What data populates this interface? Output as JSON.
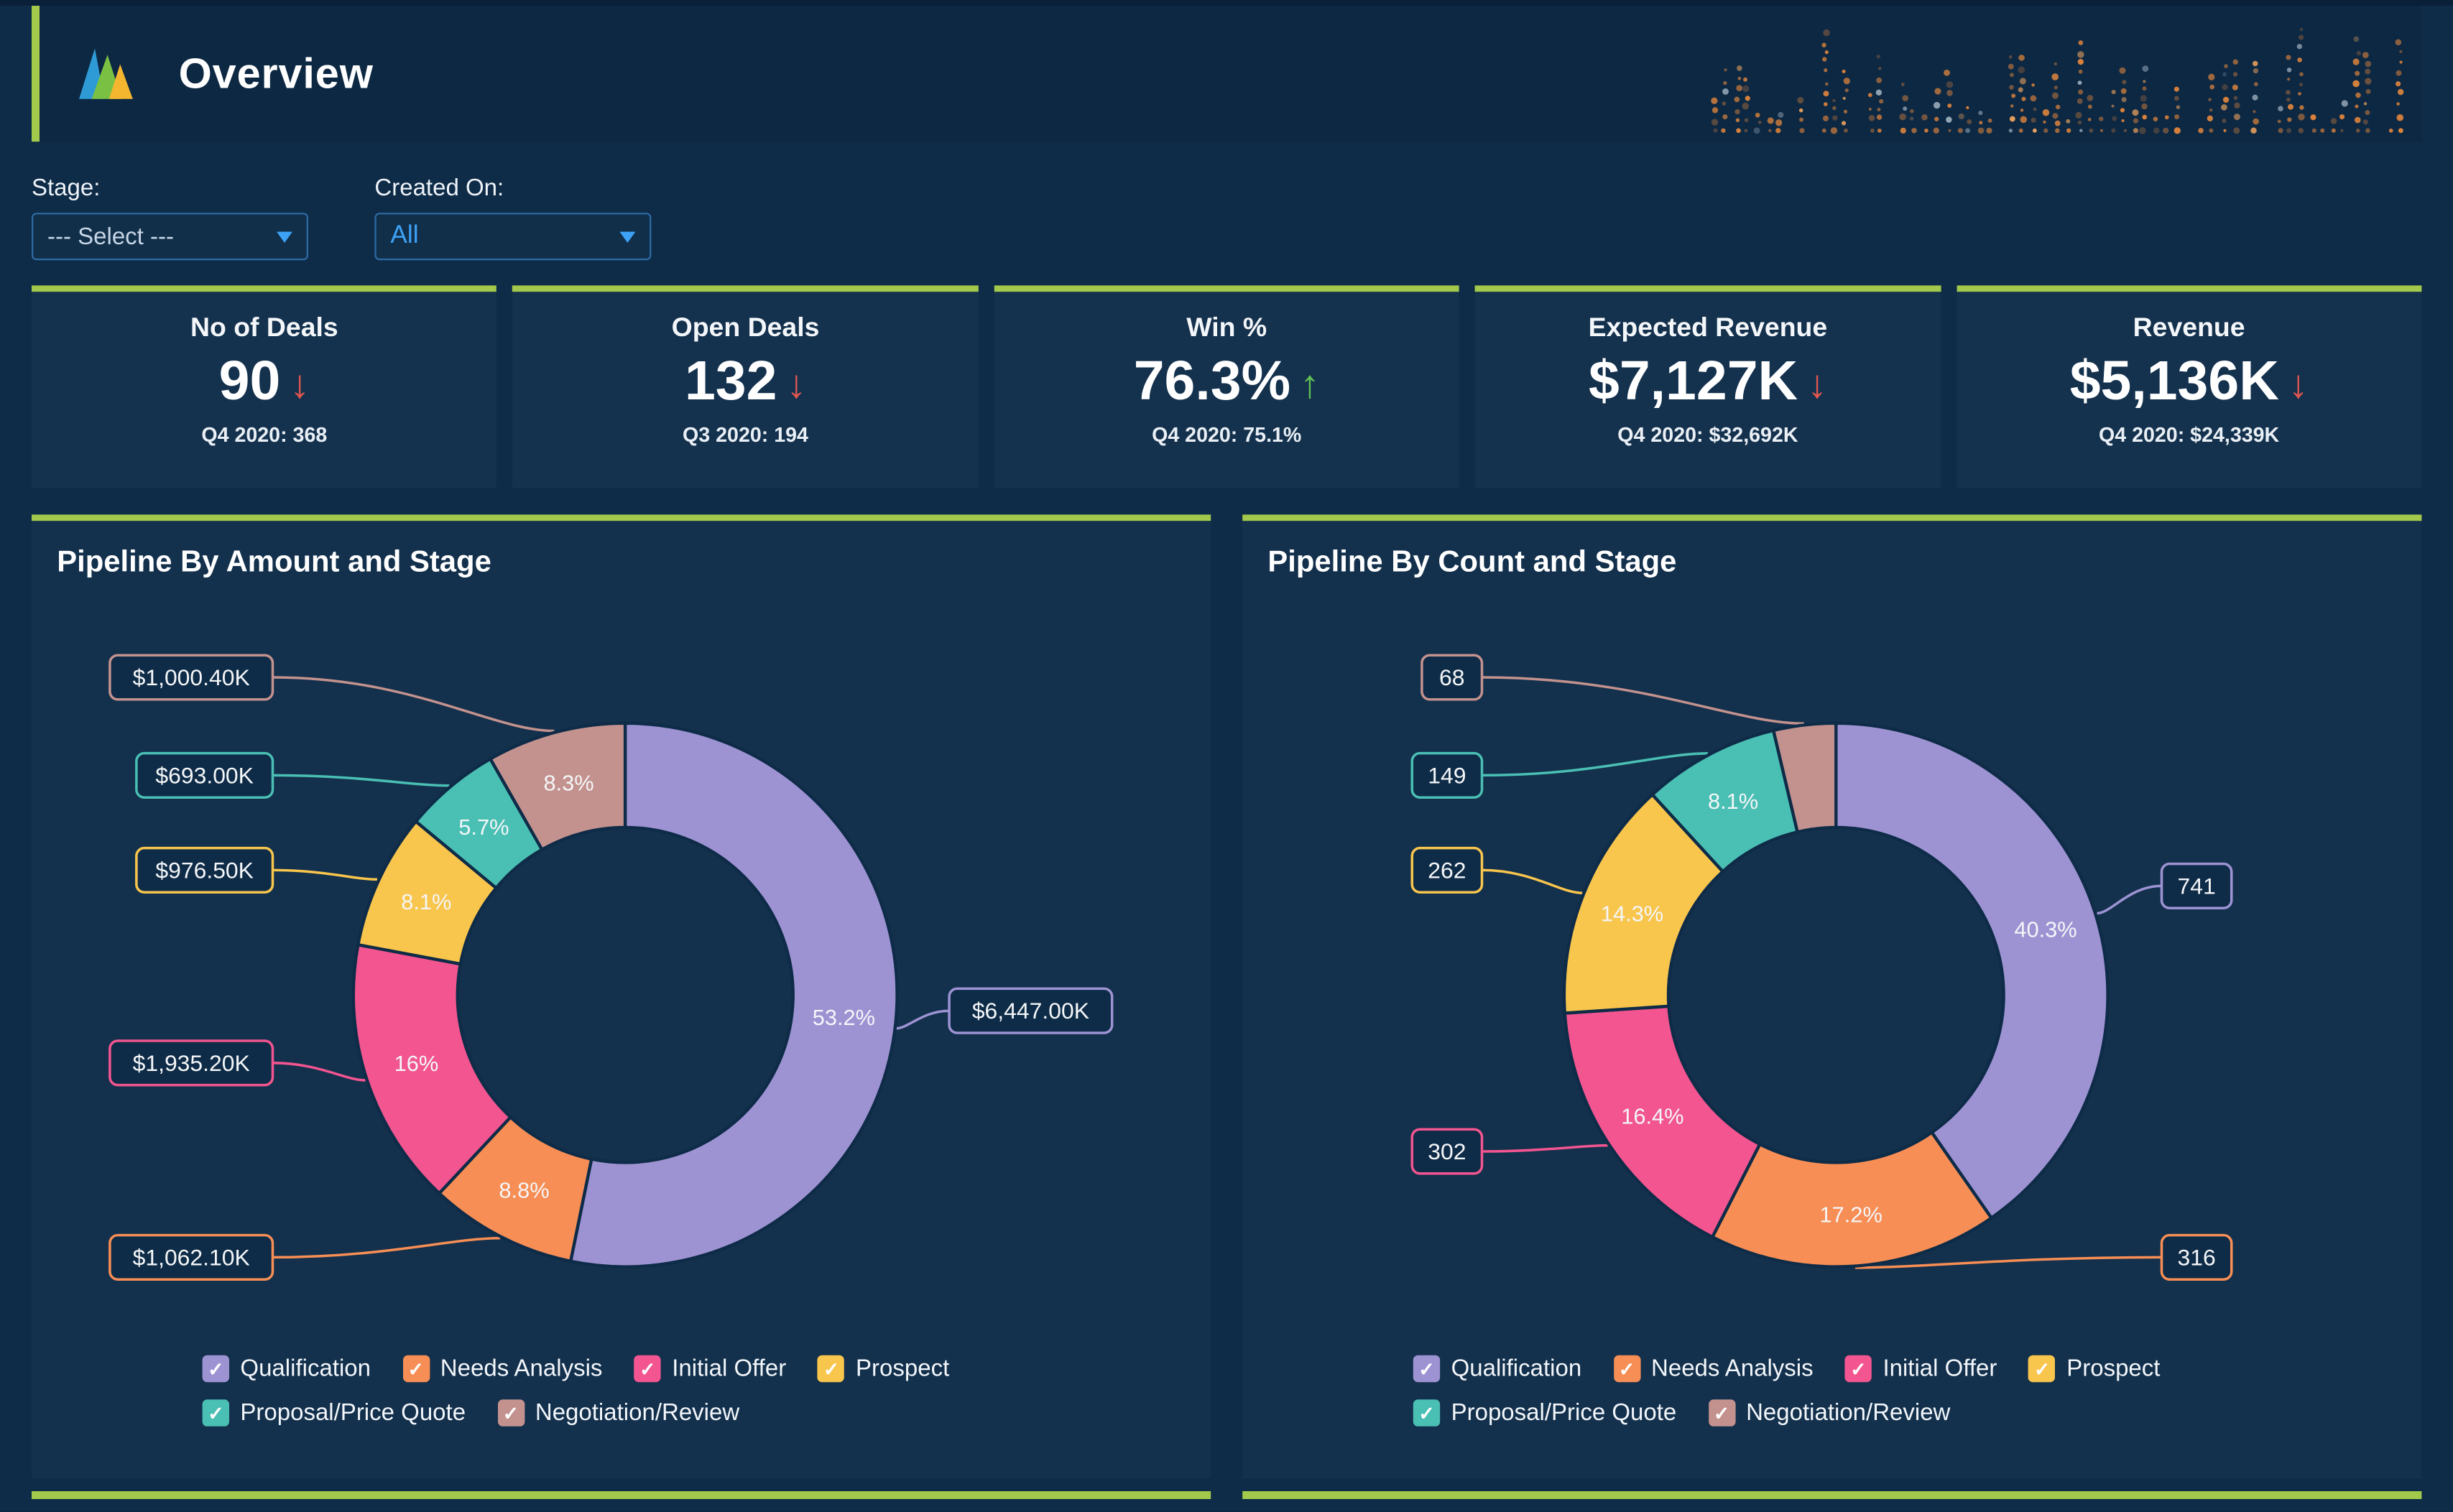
{
  "header": {
    "title": "Overview"
  },
  "filters": {
    "stage_label": "Stage:",
    "stage_value": "--- Select ---",
    "created_label": "Created On:",
    "created_value": "All"
  },
  "kpis": [
    {
      "title": "No of Deals",
      "value": "90",
      "arrow": "↓",
      "trend": "down",
      "subtitle": "Q4 2020: 368"
    },
    {
      "title": "Open Deals",
      "value": "132",
      "arrow": "↓",
      "trend": "down",
      "subtitle": "Q3 2020: 194"
    },
    {
      "title": "Win %",
      "value": "76.3%",
      "arrow": "↑",
      "trend": "up",
      "subtitle": "Q4 2020: 75.1%"
    },
    {
      "title": "Expected Revenue",
      "value": "$7,127K",
      "arrow": "↓",
      "trend": "down",
      "subtitle": "Q4 2020: $32,692K"
    },
    {
      "title": "Revenue",
      "value": "$5,136K",
      "arrow": "↓",
      "trend": "down",
      "subtitle": "Q4 2020: $24,339K"
    }
  ],
  "colors": {
    "background": "#0e2b47",
    "panel": "#13304c",
    "accent_green": "#a2c94b",
    "positive": "#5fc154",
    "negative": "#e2574f",
    "dropdown_border": "#2e6ca6",
    "dropdown_value_blue": "#3da2f5",
    "dots_orange": "#e8893c"
  },
  "chart_data": [
    {
      "type": "pie",
      "donut": true,
      "title": "Pipeline By Amount and Stage",
      "unit": "$K",
      "legend_position": "bottom",
      "slices": [
        {
          "label": "Qualification",
          "value": 6447,
          "pct": "53.2%",
          "callout": "$6,447.00K",
          "color": "#9d93d3"
        },
        {
          "label": "Needs Analysis",
          "value": 1062.1,
          "pct": "8.8%",
          "callout": "$1,062.10K",
          "color": "#f78e55"
        },
        {
          "label": "Initial Offer",
          "value": 1935.2,
          "pct": "16%",
          "callout": "$1,935.20K",
          "color": "#f2558f"
        },
        {
          "label": "Prospect",
          "value": 976.5,
          "pct": "8.1%",
          "callout": "$976.50K",
          "color": "#f8c54d"
        },
        {
          "label": "Proposal/Price Quote",
          "value": 693,
          "pct": "5.7%",
          "callout": "$693.00K",
          "color": "#4abfb4"
        },
        {
          "label": "Negotiation/Review",
          "value": 1000.4,
          "pct": "8.3%",
          "callout": "$1,000.40K",
          "color": "#c3928e"
        }
      ]
    },
    {
      "type": "pie",
      "donut": true,
      "title": "Pipeline By Count and Stage",
      "unit": "deals",
      "legend_position": "bottom",
      "slices": [
        {
          "label": "Qualification",
          "value": 741,
          "pct": "40.3%",
          "callout": "741",
          "color": "#9d93d3"
        },
        {
          "label": "Needs Analysis",
          "value": 316,
          "pct": "17.2%",
          "callout": "316",
          "color": "#f78e55"
        },
        {
          "label": "Initial Offer",
          "value": 302,
          "pct": "16.4%",
          "callout": "302",
          "color": "#f2558f"
        },
        {
          "label": "Prospect",
          "value": 262,
          "pct": "14.3%",
          "callout": "262",
          "color": "#f8c54d"
        },
        {
          "label": "Proposal/Price Quote",
          "value": 149,
          "pct": "8.1%",
          "callout": "149",
          "color": "#4abfb4"
        },
        {
          "label": "Negotiation/Review",
          "value": 68,
          "pct": "",
          "callout": "68",
          "color": "#c3928e"
        }
      ]
    }
  ]
}
